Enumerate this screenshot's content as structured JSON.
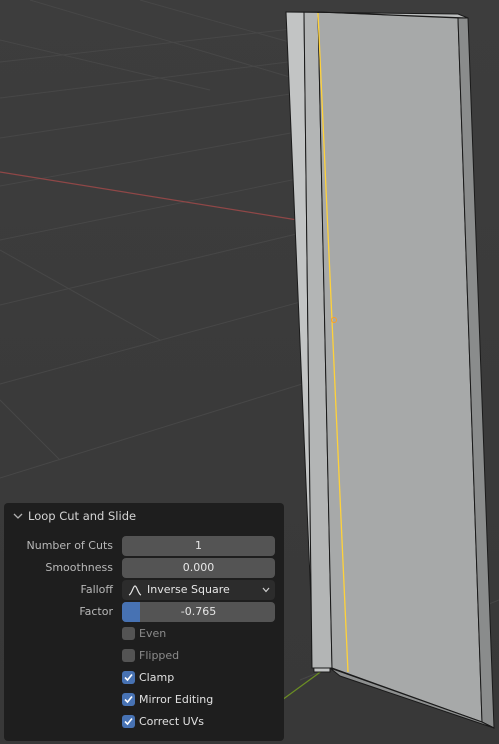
{
  "panel": {
    "title": "Loop Cut and Slide",
    "fields": {
      "number_of_cuts": {
        "label": "Number of Cuts",
        "value": "1"
      },
      "smoothness": {
        "label": "Smoothness",
        "value": "0.000"
      },
      "falloff": {
        "label": "Falloff",
        "value": "Inverse Square",
        "icon": "inverse-square-curve-icon"
      },
      "factor": {
        "label": "Factor",
        "value": "-0.765",
        "fill_fraction": 0.12
      }
    },
    "checkboxes": {
      "even": {
        "label": "Even",
        "checked": false
      },
      "flipped": {
        "label": "Flipped",
        "checked": false
      },
      "clamp": {
        "label": "Clamp",
        "checked": true
      },
      "mirror_editing": {
        "label": "Mirror Editing",
        "checked": true
      },
      "correct_uvs": {
        "label": "Correct UVs",
        "checked": true
      }
    }
  },
  "colors": {
    "viewport_bg": "#3a3a3a",
    "panel_bg": "#1e1e1e",
    "accent": "#4772b3",
    "loop_cut_highlight": "#ffd23a",
    "x_axis": "#9c4a4a",
    "y_axis": "#6b8e23"
  }
}
